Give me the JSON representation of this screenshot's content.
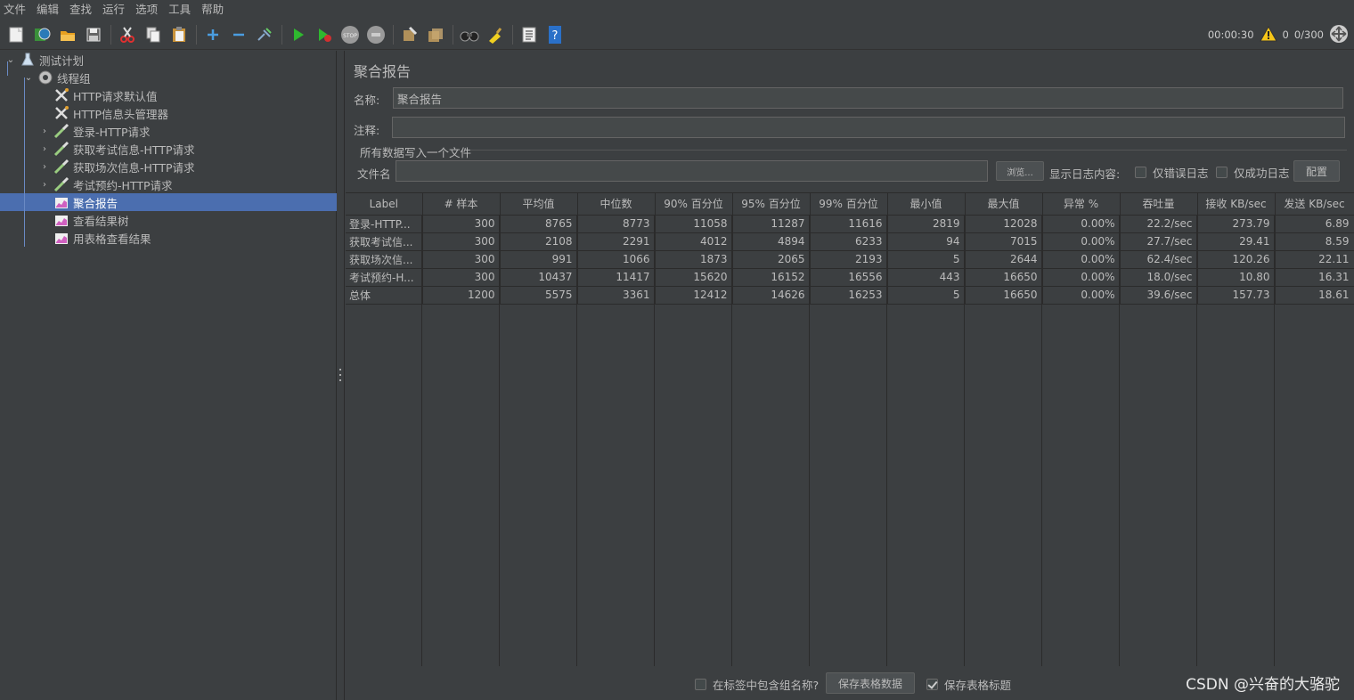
{
  "menu": [
    "文件",
    "编辑",
    "查找",
    "运行",
    "选项",
    "工具",
    "帮助"
  ],
  "toolbar": {
    "icons": [
      "new-icon",
      "templates-icon",
      "open-icon",
      "save-icon",
      "cut-icon",
      "copy-icon",
      "paste-icon",
      "expand-icon",
      "collapse-icon",
      "toggle-icon",
      "start-icon",
      "start-no-pause-icon",
      "stop-icon",
      "shutdown-icon",
      "clear-icon",
      "clear-all-icon",
      "search-icon",
      "reset-search-icon",
      "function-helper-icon",
      "help-icon"
    ],
    "elapsed": "00:00:30",
    "warnings": "0",
    "threads": "0/300"
  },
  "tree": [
    {
      "label": "测试计划",
      "icon": "flask-icon",
      "arrow": "⌄",
      "level": 0
    },
    {
      "label": "线程组",
      "icon": "gear-icon",
      "arrow": "⌄",
      "level": 1
    },
    {
      "label": "HTTP请求默认值",
      "icon": "wrench-icon",
      "arrow": "",
      "level": 2
    },
    {
      "label": "HTTP信息头管理器",
      "icon": "wrench-icon",
      "arrow": "",
      "level": 2
    },
    {
      "label": "登录-HTTP请求",
      "icon": "pipette-icon",
      "arrow": "›",
      "level": 2
    },
    {
      "label": "获取考试信息-HTTP请求",
      "icon": "pipette-icon",
      "arrow": "›",
      "level": 2
    },
    {
      "label": "获取场次信息-HTTP请求",
      "icon": "pipette-icon",
      "arrow": "›",
      "level": 2
    },
    {
      "label": "考试预约-HTTP请求",
      "icon": "pipette-icon",
      "arrow": "›",
      "level": 2
    },
    {
      "label": "聚合报告",
      "icon": "chart-icon",
      "arrow": "",
      "level": 2,
      "selected": true
    },
    {
      "label": "查看结果树",
      "icon": "chart-icon",
      "arrow": "",
      "level": 2
    },
    {
      "label": "用表格查看结果",
      "icon": "chart-icon",
      "arrow": "",
      "level": 2
    }
  ],
  "panel": {
    "title": "聚合报告",
    "name_label": "名称:",
    "name_value": "聚合报告",
    "comment_label": "注释:",
    "comment_value": "",
    "group_title": "所有数据写入一个文件",
    "filename_label": "文件名",
    "filename_value": "",
    "browse_label": "浏览...",
    "log_label": "显示日志内容:",
    "errors_only_label": "仅错误日志",
    "success_only_label": "仅成功日志",
    "configure_label": "配置"
  },
  "table": {
    "headers": [
      "Label",
      "# 样本",
      "平均值",
      "中位数",
      "90% 百分位",
      "95% 百分位",
      "99% 百分位",
      "最小值",
      "最大值",
      "异常 %",
      "吞吐量",
      "接收 KB/sec",
      "发送 KB/sec"
    ],
    "rows": [
      [
        "登录-HTTP...",
        "300",
        "8765",
        "8773",
        "11058",
        "11287",
        "11616",
        "2819",
        "12028",
        "0.00%",
        "22.2/sec",
        "273.79",
        "6.89"
      ],
      [
        "获取考试信...",
        "300",
        "2108",
        "2291",
        "4012",
        "4894",
        "6233",
        "94",
        "7015",
        "0.00%",
        "27.7/sec",
        "29.41",
        "8.59"
      ],
      [
        "获取场次信...",
        "300",
        "991",
        "1066",
        "1873",
        "2065",
        "2193",
        "5",
        "2644",
        "0.00%",
        "62.4/sec",
        "120.26",
        "22.11"
      ],
      [
        "考试预约-H...",
        "300",
        "10437",
        "11417",
        "15620",
        "16152",
        "16556",
        "443",
        "16650",
        "0.00%",
        "18.0/sec",
        "10.80",
        "16.31"
      ],
      [
        "总体",
        "1200",
        "5575",
        "3361",
        "12412",
        "14626",
        "16253",
        "5",
        "16650",
        "0.00%",
        "39.6/sec",
        "157.73",
        "18.61"
      ]
    ]
  },
  "bottom": {
    "include_group_label": "在标签中包含组名称?",
    "save_data_label": "保存表格数据",
    "save_header_label": "保存表格标题"
  },
  "watermark": "CSDN @兴奋的大骆驼"
}
